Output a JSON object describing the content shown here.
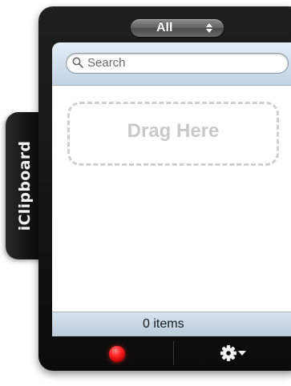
{
  "side_tab": {
    "label": "iClipboard"
  },
  "selector": {
    "label": "All",
    "icon": "updown-arrows-icon"
  },
  "search": {
    "placeholder": "Search",
    "icon": "search-icon"
  },
  "drop_zone": {
    "label": "Drag Here"
  },
  "status": {
    "text": "0 items"
  },
  "toolbar": {
    "record_icon": "record-icon",
    "settings_icon": "gear-icon",
    "settings_menu_icon": "dropdown-arrow-icon"
  },
  "colors": {
    "frame": "#111111",
    "panel_header": "#c9d8e7",
    "record": "#ff2a2a",
    "drop_zone_border": "#cfcfcf",
    "drop_zone_text": "#c9c9c9"
  }
}
